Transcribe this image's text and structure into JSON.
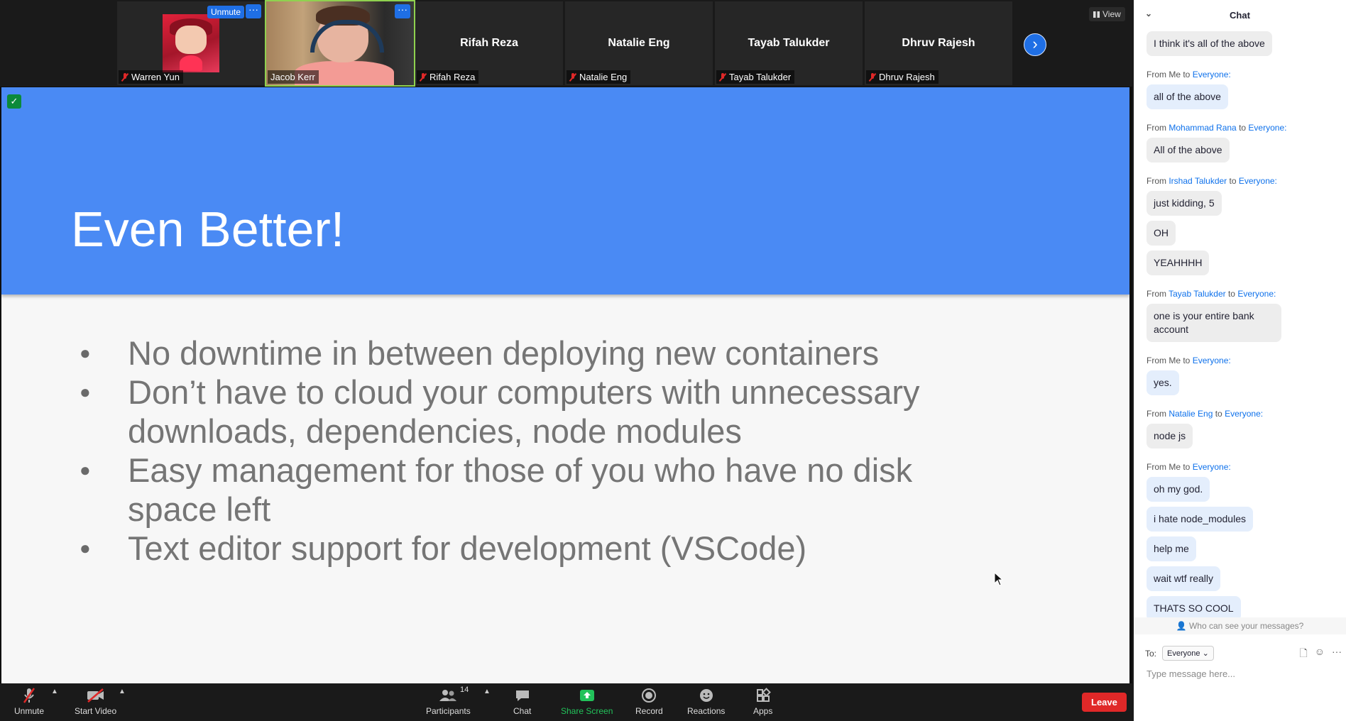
{
  "participants_strip": {
    "tiles": [
      {
        "name": "Warren Yun"
      },
      {
        "name": "Jacob Kerr"
      },
      {
        "name": "Rifah Reza",
        "display": "Rifah Reza"
      },
      {
        "name": "Natalie Eng",
        "display": "Natalie Eng"
      },
      {
        "name": "Tayab Talukder",
        "display": "Tayab Talukder"
      },
      {
        "name": "Dhruv Rajesh",
        "display": "Dhruv Rajesh"
      }
    ],
    "unmute_label": "Unmute",
    "more_label": "···",
    "view_label": "View"
  },
  "slide": {
    "title": "Even Better!",
    "bullets": [
      "No downtime in between deploying new containers",
      "Don’t have to cloud your computers with unnecessary downloads, dependencies, node modules",
      "Easy management for those of you who have no disk space left",
      "Text editor support for development (VSCode)"
    ]
  },
  "toolbar": {
    "unmute": "Unmute",
    "start_video": "Start Video",
    "participants": "Participants",
    "participants_count": "14",
    "chat": "Chat",
    "share_screen": "Share Screen",
    "record": "Record",
    "reactions": "Reactions",
    "apps": "Apps",
    "leave": "Leave"
  },
  "chat": {
    "title": "Chat",
    "messages": [
      {
        "from": "",
        "bubbles": [
          "I think it's all of the above"
        ],
        "me": false
      },
      {
        "from_prefix": "From Me to ",
        "from_to": "Everyone:",
        "bubbles": [
          "all of the above"
        ],
        "me": true
      },
      {
        "from_prefix": "From ",
        "sender": "Mohammad Rana",
        "to": " to ",
        "from_to": "Everyone:",
        "bubbles": [
          "All of the above"
        ],
        "me": false
      },
      {
        "from_prefix": "From ",
        "sender": "Irshad Talukder",
        "to": " to ",
        "from_to": "Everyone:",
        "bubbles": [
          "just kidding, 5",
          "OH",
          "YEAHHHH"
        ],
        "me": false
      },
      {
        "from_prefix": "From ",
        "sender": "Tayab Talukder",
        "to": " to ",
        "from_to": "Everyone:",
        "bubbles": [
          "one is your entire bank account"
        ],
        "me": false
      },
      {
        "from_prefix": "From Me to ",
        "from_to": "Everyone:",
        "bubbles": [
          "yes."
        ],
        "me": true
      },
      {
        "from_prefix": "From ",
        "sender": "Natalie Eng",
        "to": " to ",
        "from_to": "Everyone:",
        "bubbles": [
          "node js"
        ],
        "me": false
      },
      {
        "from_prefix": "From Me to ",
        "from_to": "Everyone:",
        "bubbles": [
          "oh my god.",
          "i hate node_modules",
          "help me",
          "wait wtf really",
          "THATS SO COOL"
        ],
        "me": true
      }
    ],
    "who_can_see": "Who can see your messages?",
    "to_label": "To:",
    "to_value": "Everyone",
    "input_placeholder": "Type message here..."
  },
  "colors": {
    "accent": "#0e71eb",
    "slide_header": "#4a8af4",
    "leave": "#e02828",
    "share_green": "#22c25a"
  }
}
